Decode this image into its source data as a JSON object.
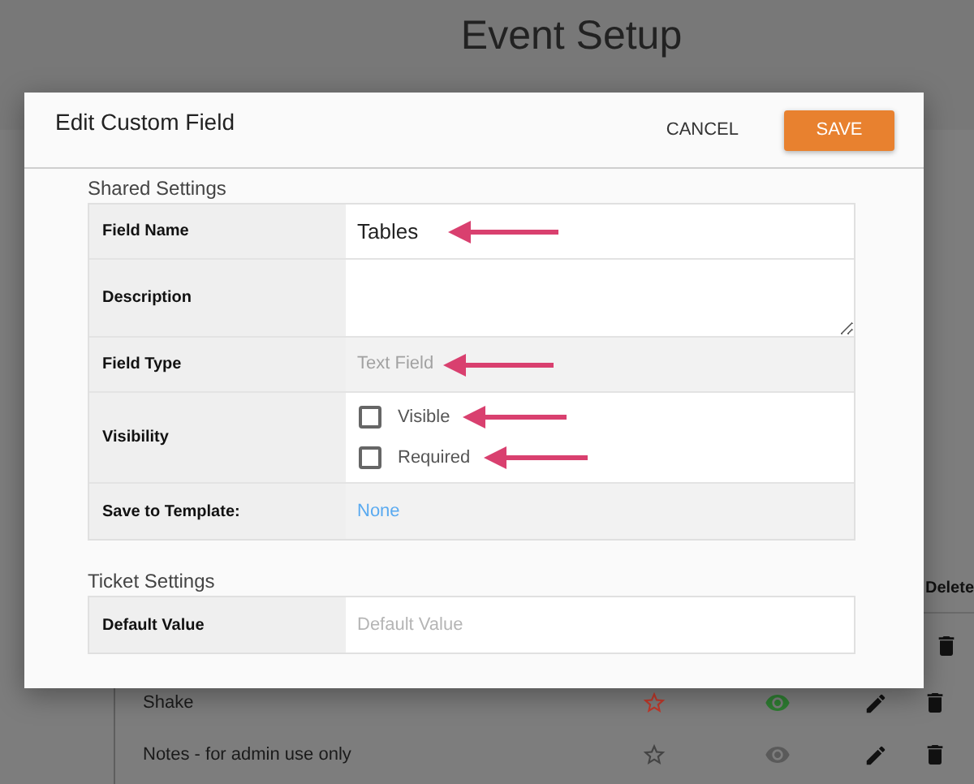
{
  "page": {
    "title": "Event Setup"
  },
  "background_table": {
    "columns": [
      {
        "label": "Delete"
      }
    ],
    "rows": [
      {
        "kind": "covered"
      },
      {
        "kind": "row",
        "name": "Shake",
        "required": true,
        "visible": true
      },
      {
        "kind": "row",
        "name": "Notes - for admin use only",
        "required": false,
        "visible": false
      }
    ]
  },
  "dialog": {
    "title": "Edit Custom Field",
    "buttons": [
      {
        "kind": "text",
        "label": "CANCEL"
      },
      {
        "kind": "primary",
        "label": "SAVE"
      }
    ],
    "sections": [
      {
        "title": "Shared Settings",
        "rows": [
          {
            "kind": "input",
            "label": "Field Name",
            "value": "Tables",
            "arrow": true
          },
          {
            "kind": "textarea",
            "label": "Description"
          },
          {
            "kind": "readonly",
            "label": "Field Type",
            "value": "Text Field",
            "arrow": true
          },
          {
            "kind": "checkboxes",
            "label": "Visibility",
            "options": [
              {
                "label": "Visible",
                "checked": false,
                "arrow": true
              },
              {
                "label": "Required",
                "checked": false,
                "arrow": true
              }
            ]
          },
          {
            "kind": "link",
            "label": "Save to Template:",
            "value": "None"
          }
        ]
      },
      {
        "title": "Ticket Settings",
        "rows": [
          {
            "kind": "input",
            "label": "Default Value",
            "placeholder": "Default Value"
          }
        ]
      }
    ]
  }
}
